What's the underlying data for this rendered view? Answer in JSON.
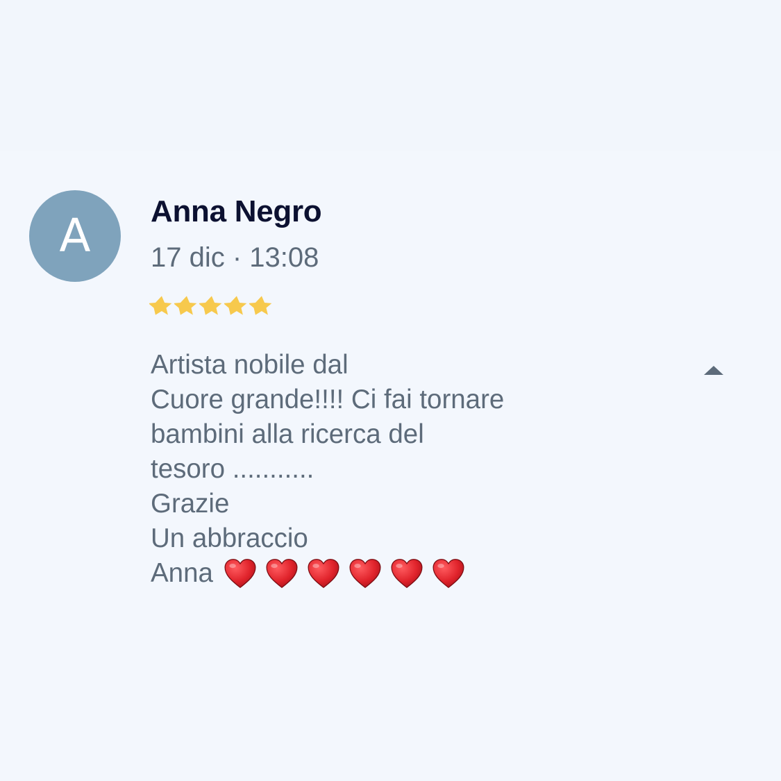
{
  "colors": {
    "background": "#f3f7fd",
    "avatar_bg": "#7fa3bc",
    "star": "#f7c94d",
    "heart": "#e0232b",
    "author": "#0c1131",
    "secondary_text": "#5d6b7a"
  },
  "review": {
    "avatar_initial": "A",
    "author": "Anna Negro",
    "date": "17 dic · 13:08",
    "rating": 5,
    "rating_max": 5,
    "text_lines": [
      "Artista nobile dal",
      "Cuore grande!!!! Ci fai tornare",
      "bambini alla ricerca del",
      "tesoro ...........",
      "Grazie",
      "Un abbraccio",
      "Anna"
    ],
    "hearts_count": 6,
    "heart_icon": "red-heart-icon",
    "star_icon": "star-icon",
    "collapse_icon": "chevron-up-icon"
  }
}
